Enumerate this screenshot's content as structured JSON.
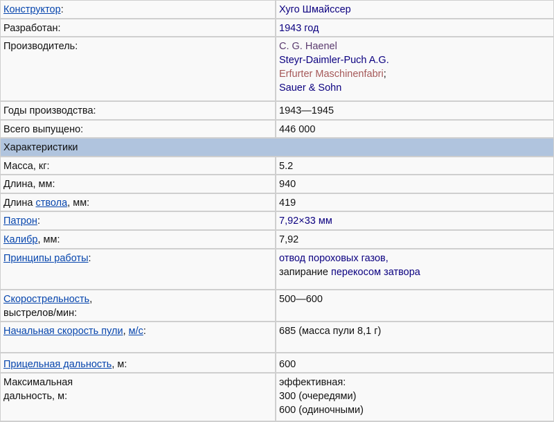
{
  "colors": {
    "link": "#0645ad",
    "visited": "#0b0080",
    "visited_purple": "#5a3a6e",
    "redlink": "#a55858",
    "header_bg": "#b0c4de"
  },
  "rows": {
    "designer": {
      "label": "Конструктор",
      "value": "Хуго Шмайссер"
    },
    "developed": {
      "label": "Разработан:",
      "value": "1943 год"
    },
    "manufacturer": {
      "label": "Производитель:",
      "values": [
        "C. G. Haenel",
        "Steyr-Daimler-Puch A.G.",
        "Erfurter Maschinenfabri",
        "Sauer & Sohn"
      ]
    },
    "years": {
      "label": "Годы производства:",
      "value": "1943—1945"
    },
    "total": {
      "label": "Всего выпущено:",
      "value": "446 000"
    },
    "section": "Характеристики",
    "mass": {
      "label": "Масса, кг:",
      "value": "5.2"
    },
    "length": {
      "label": "Длина, мм:",
      "value": "940"
    },
    "barrel": {
      "label_pre": "Длина ",
      "label_link": "ствола",
      "label_post": ", мм:",
      "value": "419"
    },
    "cartridge": {
      "label": "Патрон",
      "value": "7,92×33 мм"
    },
    "caliber": {
      "label": "Калибр",
      "label_post": ", мм:",
      "value": "7,92"
    },
    "principles": {
      "label": "Принципы работы",
      "value_line1": "отвод пороховых газов,",
      "value_line2_pre": "запирание ",
      "value_line2_link": "перекосом затвора"
    },
    "rate": {
      "label": "Скорострельность",
      "label_post": "выстрелов/мин:",
      "value": "500—600"
    },
    "velocity": {
      "label": "Начальная скорость пули",
      "label_link2": "м/с",
      "value": "685 (масса пули 8,1 г)"
    },
    "sight": {
      "label": "Прицельная дальность",
      "label_post": ", м:",
      "value": "600"
    },
    "maxrange": {
      "label_line1": "Максимальная",
      "label_line2": "дальность, м:",
      "value_line1": "эффективная:",
      "value_line2": "300 (очередями)",
      "value_line3": "600 (одиночными)"
    }
  }
}
